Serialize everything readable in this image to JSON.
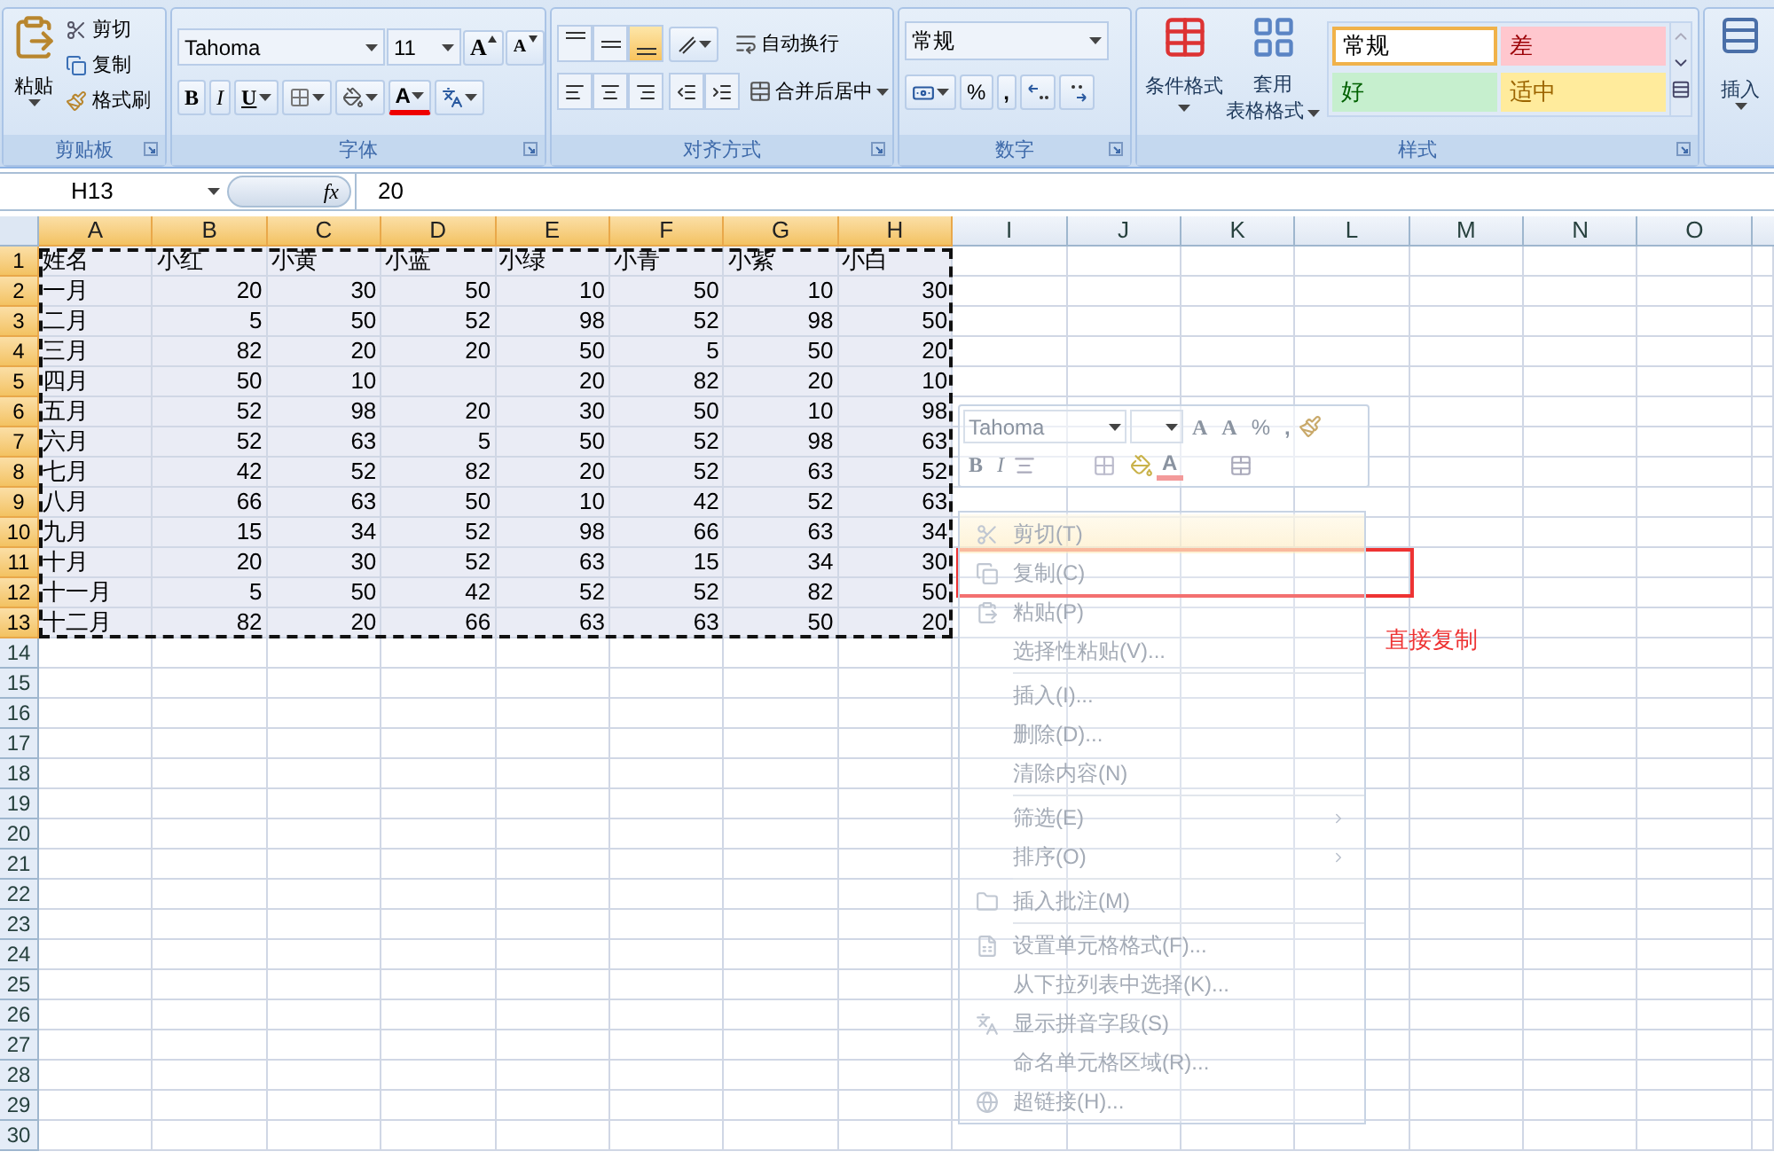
{
  "clipboard": {
    "title": "剪贴板",
    "paste": "粘贴",
    "cut": "剪切",
    "copy": "复制",
    "format_painter": "格式刷"
  },
  "font": {
    "title": "字体",
    "font_name": "Tahoma",
    "font_size": "11",
    "grow": "A",
    "shrink": "A",
    "bold": "B",
    "italic": "I",
    "underline": "U",
    "font_color": "A"
  },
  "alignment": {
    "title": "对齐方式",
    "vertical": [
      {
        "selected": false
      },
      {
        "selected": false
      },
      {
        "selected": true
      }
    ],
    "wrap": "自动换行",
    "merge": "合并后居中"
  },
  "number": {
    "title": "数字",
    "format": "常规",
    "percent": "%",
    "comma": ","
  },
  "styles": {
    "title": "样式",
    "conditional": "条件格式",
    "table_format": [
      "套用",
      "表格格式"
    ],
    "gallery": [
      {
        "label": "常规",
        "kind": "normal",
        "selected": true
      },
      {
        "label": "差",
        "kind": "bad",
        "selected": false
      },
      {
        "label": "好",
        "kind": "good",
        "selected": false
      },
      {
        "label": "适中",
        "kind": "neutral",
        "selected": false
      }
    ]
  },
  "cells": {
    "insert": "插入"
  },
  "formula_bar": {
    "name_box": "H13",
    "fx": "fx",
    "value": "20"
  },
  "sheet": {
    "copy_marquee": true,
    "columns": [
      {
        "label": "A",
        "selected": true
      },
      {
        "label": "B",
        "selected": true
      },
      {
        "label": "C",
        "selected": true
      },
      {
        "label": "D",
        "selected": true
      },
      {
        "label": "E",
        "selected": true
      },
      {
        "label": "F",
        "selected": true
      },
      {
        "label": "G",
        "selected": true
      },
      {
        "label": "H",
        "selected": true
      },
      {
        "label": "I",
        "selected": false
      },
      {
        "label": "J",
        "selected": false
      },
      {
        "label": "K",
        "selected": false
      },
      {
        "label": "L",
        "selected": false
      },
      {
        "label": "M",
        "selected": false
      },
      {
        "label": "N",
        "selected": false
      },
      {
        "label": "O",
        "selected": false
      }
    ],
    "rows": [
      {
        "label": "1",
        "selected": true,
        "cells": [
          "姓名",
          "小红",
          "小黄",
          "小蓝",
          "小绿",
          "小青",
          "小紫",
          "小白"
        ]
      },
      {
        "label": "2",
        "selected": true,
        "cells": [
          "一月",
          "20",
          "30",
          "50",
          "10",
          "50",
          "10",
          "30"
        ]
      },
      {
        "label": "3",
        "selected": true,
        "cells": [
          "二月",
          "5",
          "50",
          "52",
          "98",
          "52",
          "98",
          "50"
        ]
      },
      {
        "label": "4",
        "selected": true,
        "cells": [
          "三月",
          "82",
          "20",
          "20",
          "50",
          "5",
          "50",
          "20"
        ]
      },
      {
        "label": "5",
        "selected": true,
        "cells": [
          "四月",
          "50",
          "10",
          null,
          "20",
          "82",
          "20",
          "10"
        ]
      },
      {
        "label": "6",
        "selected": true,
        "cells": [
          "五月",
          "52",
          "98",
          "20",
          "30",
          "50",
          "10",
          "98"
        ]
      },
      {
        "label": "7",
        "selected": true,
        "cells": [
          "六月",
          "52",
          "63",
          "5",
          "50",
          "52",
          "98",
          "63"
        ]
      },
      {
        "label": "8",
        "selected": true,
        "cells": [
          "七月",
          "42",
          "52",
          "82",
          "20",
          "52",
          "63",
          "52"
        ]
      },
      {
        "label": "9",
        "selected": true,
        "cells": [
          "八月",
          "66",
          "63",
          "50",
          "10",
          "42",
          "52",
          "63"
        ]
      },
      {
        "label": "10",
        "selected": true,
        "cells": [
          "九月",
          "15",
          "34",
          "52",
          "98",
          "66",
          "63",
          "34"
        ]
      },
      {
        "label": "11",
        "selected": true,
        "cells": [
          "十月",
          "20",
          "30",
          "52",
          "63",
          "15",
          "34",
          "30"
        ]
      },
      {
        "label": "12",
        "selected": true,
        "cells": [
          "十一月",
          "5",
          "50",
          "42",
          "52",
          "52",
          "82",
          "50"
        ]
      },
      {
        "label": "13",
        "selected": true,
        "cells": [
          "十二月",
          "82",
          "20",
          "66",
          "63",
          "63",
          "50",
          "20"
        ]
      },
      {
        "label": "14",
        "selected": false,
        "cells": []
      },
      {
        "label": "15",
        "selected": false,
        "cells": []
      },
      {
        "label": "16",
        "selected": false,
        "cells": []
      },
      {
        "label": "17",
        "selected": false,
        "cells": []
      },
      {
        "label": "18",
        "selected": false,
        "cells": []
      },
      {
        "label": "19",
        "selected": false,
        "cells": []
      },
      {
        "label": "20",
        "selected": false,
        "cells": []
      },
      {
        "label": "21",
        "selected": false,
        "cells": []
      },
      {
        "label": "22",
        "selected": false,
        "cells": []
      },
      {
        "label": "23",
        "selected": false,
        "cells": []
      },
      {
        "label": "24",
        "selected": false,
        "cells": []
      },
      {
        "label": "25",
        "selected": false,
        "cells": []
      },
      {
        "label": "26",
        "selected": false,
        "cells": []
      },
      {
        "label": "27",
        "selected": false,
        "cells": []
      },
      {
        "label": "28",
        "selected": false,
        "cells": []
      },
      {
        "label": "29",
        "selected": false,
        "cells": []
      },
      {
        "label": "30",
        "selected": false,
        "cells": []
      }
    ]
  },
  "mini_toolbar": {
    "font_name": "Tahoma",
    "grow": "A",
    "shrink": "A",
    "percent": "%",
    "comma": ",",
    "bold": "B",
    "italic": "I",
    "font_color": "A"
  },
  "context_menu": {
    "items": [
      {
        "kind": "item",
        "label": "剪切(T)",
        "selected": true,
        "submenu": false
      },
      {
        "kind": "item",
        "label": "复制(C)",
        "selected": false,
        "submenu": false
      },
      {
        "kind": "item",
        "label": "粘贴(P)",
        "selected": false,
        "submenu": false
      },
      {
        "kind": "item",
        "label": "选择性粘贴(V)...",
        "selected": false,
        "submenu": false
      },
      {
        "kind": "separator"
      },
      {
        "kind": "item",
        "label": "插入(I)...",
        "selected": false,
        "submenu": false
      },
      {
        "kind": "item",
        "label": "删除(D)...",
        "selected": false,
        "submenu": false
      },
      {
        "kind": "item",
        "label": "清除内容(N)",
        "selected": false,
        "submenu": false
      },
      {
        "kind": "separator"
      },
      {
        "kind": "item",
        "label": "筛选(E)",
        "selected": false,
        "submenu": true
      },
      {
        "kind": "item",
        "label": "排序(O)",
        "selected": false,
        "submenu": true
      },
      {
        "kind": "separator"
      },
      {
        "kind": "item",
        "label": "插入批注(M)",
        "selected": false,
        "submenu": false
      },
      {
        "kind": "separator"
      },
      {
        "kind": "item",
        "label": "设置单元格格式(F)...",
        "selected": false,
        "submenu": false
      },
      {
        "kind": "item",
        "label": "从下拉列表中选择(K)...",
        "selected": false,
        "submenu": false
      },
      {
        "kind": "item",
        "label": "显示拼音字段(S)",
        "selected": false,
        "submenu": false
      },
      {
        "kind": "item",
        "label": "命名单元格区域(R)...",
        "selected": false,
        "submenu": false
      },
      {
        "kind": "item",
        "label": "超链接(H)...",
        "selected": false,
        "submenu": false
      }
    ]
  },
  "annotation": {
    "text": "直接复制"
  }
}
